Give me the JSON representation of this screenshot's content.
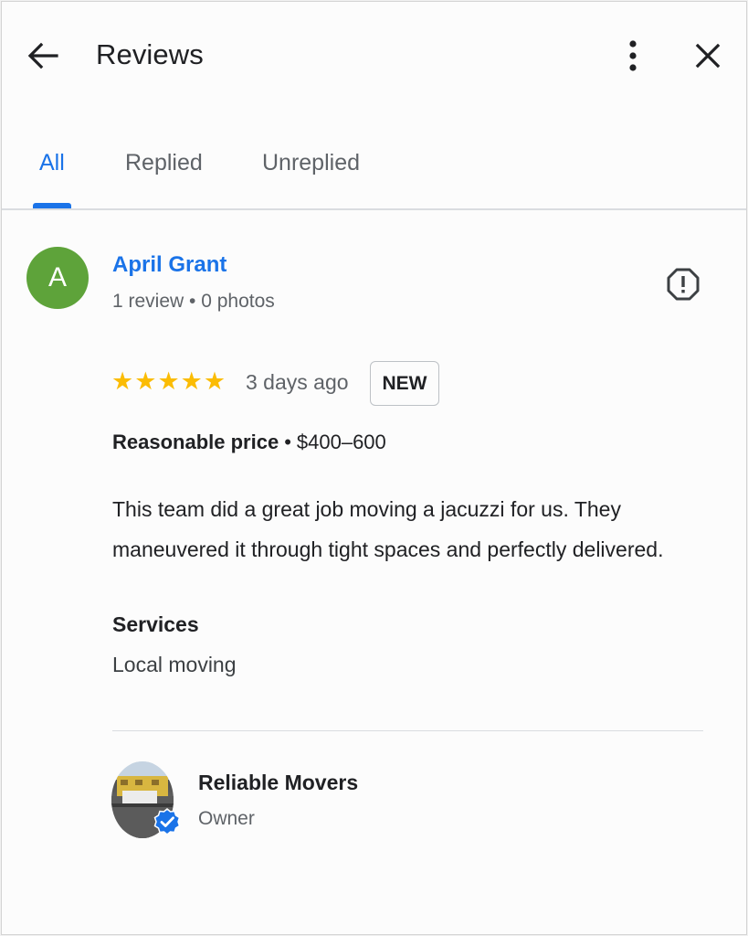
{
  "header": {
    "title": "Reviews",
    "back_icon": "arrow-back-icon",
    "more_icon": "more-vert-icon",
    "close_icon": "close-icon"
  },
  "tabs": [
    {
      "label": "All",
      "active": true
    },
    {
      "label": "Replied",
      "active": false
    },
    {
      "label": "Unreplied",
      "active": false
    }
  ],
  "review": {
    "avatar_letter": "A",
    "avatar_color": "#5ea33a",
    "name": "April Grant",
    "meta": "1 review • 0 photos",
    "report_icon": "report-icon",
    "rating": 5,
    "time": "3 days ago",
    "badge": "NEW",
    "price_label": "Reasonable price",
    "price_separator": "•",
    "price_value": "$400–600",
    "text": "This team did a great job moving a jacuzzi for us. They maneuvered it through tight spaces and perfectly delivered.",
    "services_heading": "Services",
    "services_value": "Local moving"
  },
  "owner": {
    "name": "Reliable Movers",
    "role": "Owner",
    "verified_icon": "verified-icon"
  },
  "colors": {
    "accent": "#1a73e8",
    "star": "#fbbc04",
    "text": "#202124",
    "secondary": "#5f6368"
  }
}
